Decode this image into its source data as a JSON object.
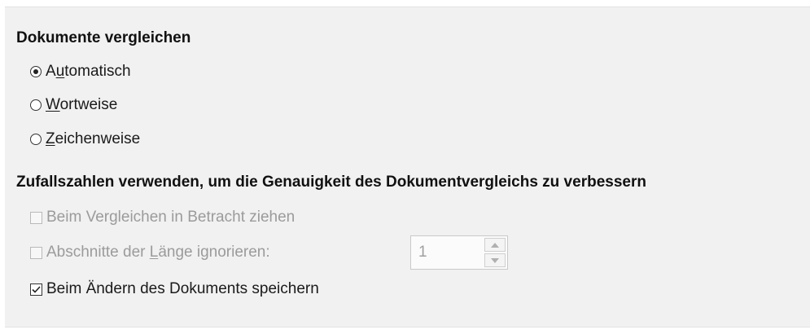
{
  "compare": {
    "heading": "Dokumente vergleichen",
    "options": [
      {
        "pre": "A",
        "mnemonic": "u",
        "post": "tomatisch",
        "selected": true
      },
      {
        "pre": "",
        "mnemonic": "W",
        "post": "ortweise",
        "selected": false
      },
      {
        "pre": "",
        "mnemonic": "Z",
        "post": "eichenweise",
        "selected": false
      }
    ]
  },
  "random": {
    "heading": "Zufallszahlen verwenden, um die Genauigkeit des Dokumentvergleichs zu verbessern",
    "consider": {
      "label": "Beim Vergleichen in Betracht ziehen",
      "checked": false,
      "enabled": false
    },
    "ignore": {
      "pre": "Abschnitte der ",
      "mnemonic": "L",
      "post": "änge ignorieren:",
      "checked": false,
      "enabled": false
    },
    "length_value": "1",
    "store": {
      "label": "Beim Ändern des Dokuments speichern",
      "checked": true,
      "enabled": true
    }
  },
  "icons": {
    "spin_up": "arrow-up-icon",
    "spin_down": "arrow-down-icon",
    "check": "check-icon"
  }
}
